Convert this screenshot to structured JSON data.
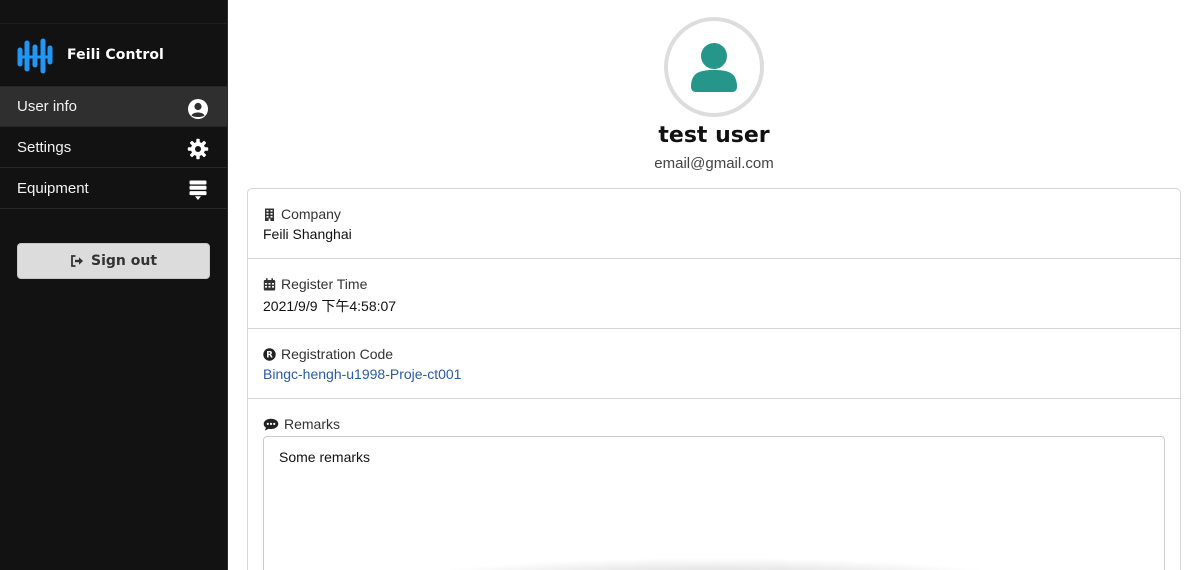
{
  "app": {
    "brand_name": "Feili Control",
    "brand_icon": "waveform-logo-icon",
    "accent_color": "#2196f3"
  },
  "sidebar": {
    "items": [
      {
        "label": "User info",
        "icon": "user-circle-icon",
        "active": true
      },
      {
        "label": "Settings",
        "icon": "gear-icon",
        "active": false
      },
      {
        "label": "Equipment",
        "icon": "server-stack-icon",
        "active": false
      }
    ],
    "sign_out_label": "Sign out"
  },
  "profile": {
    "name": "test user",
    "email": "email@gmail.com",
    "avatar_color": "#26968a"
  },
  "details": {
    "company_label": "Company",
    "company_value": "Feili Shanghai",
    "register_time_label": "Register Time",
    "register_time_value": "2021/9/9 下午4:58:07",
    "registration_code_label": "Registration Code",
    "registration_code_value": "Bingc-hengh-u1998-Proje-ct001",
    "remarks_label": "Remarks",
    "remarks_value": "Some remarks"
  }
}
